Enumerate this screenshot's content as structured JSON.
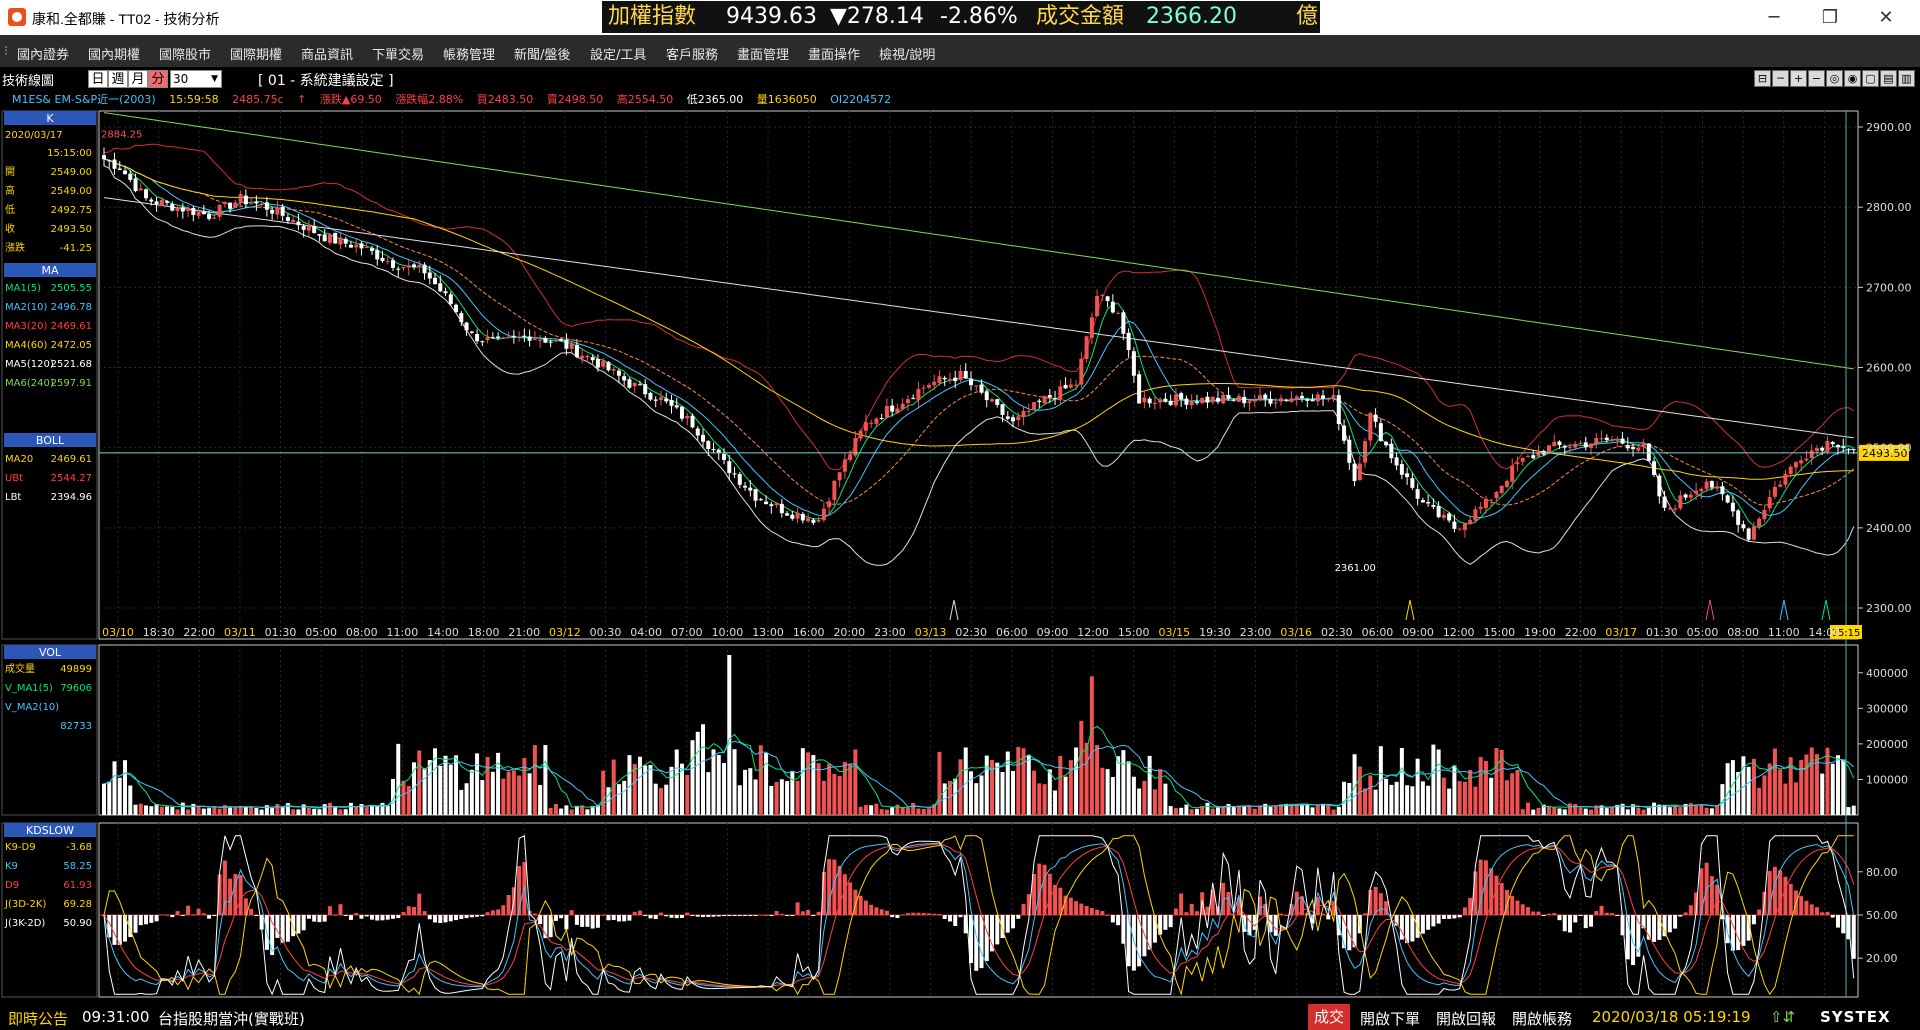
{
  "window": {
    "title": "康和.全都賺 - TT02 - 技術分析",
    "minimize": "─",
    "restore": "❐",
    "close": "✕"
  },
  "ticker": {
    "index_name": "加權指數",
    "index_value": "9439.63",
    "change": "▼278.14",
    "change_pct": "-2.86%",
    "turnover_label": "成交金額",
    "turnover_value": "2366.20",
    "unit": "億"
  },
  "menu": [
    "國內證券",
    "國內期權",
    "國際股市",
    "國際期權",
    "商品資訊",
    "下單交易",
    "帳務管理",
    "新聞/盤後",
    "設定/工具",
    "客戶服務",
    "畫面管理",
    "畫面操作",
    "檢視/說明"
  ],
  "toolbar": {
    "label": "技術線圖",
    "periods": [
      "日",
      "週",
      "月",
      "分"
    ],
    "period_value": "30",
    "setting": "[ 01 - 系統建議設定 ]",
    "buttons": [
      "⊟",
      "─",
      "+",
      "−",
      "◎",
      "◉",
      "▢",
      "▤",
      "▥"
    ]
  },
  "quote": {
    "symbol": "M1ES&  EM-S&P近一(2003)",
    "time": "15:59:58",
    "last": "2485.75c",
    "arrow": "↑",
    "change": "漲跌▲69.50",
    "change_pct": "漲跌幅2.88%",
    "bid": "買2483.50",
    "ask": "賣2498.50",
    "high": "高2554.50",
    "low": "低2365.00",
    "volume": "量1636050",
    "oi": "OI2204572"
  },
  "panels": {
    "k": {
      "header": "K",
      "date": "2020/03/17",
      "time": "15:15:00",
      "rows": [
        {
          "label": "開",
          "value": "2549.00"
        },
        {
          "label": "高",
          "value": "2549.00"
        },
        {
          "label": "低",
          "value": "2492.75"
        },
        {
          "label": "收",
          "value": "2493.50"
        },
        {
          "label": "漲跌",
          "value": "-41.25"
        }
      ]
    },
    "ma": {
      "header": "MA",
      "rows": [
        {
          "label": "MA1(5)",
          "value": "2505.55",
          "color": "#00e676"
        },
        {
          "label": "MA2(10)",
          "value": "2496.78",
          "color": "#40c4ff"
        },
        {
          "label": "MA3(20)",
          "value": "2469.61",
          "color": "#ff4040"
        },
        {
          "label": "MA4(60)",
          "value": "2472.05",
          "color": "#ffd600"
        },
        {
          "label": "MA5(120)",
          "value": "2521.68",
          "color": "#ffffff"
        },
        {
          "label": "MA6(240)",
          "value": "2597.91",
          "color": "#7ed957"
        }
      ]
    },
    "boll": {
      "header": "BOLL",
      "rows": [
        {
          "label": "MA20",
          "value": "2469.61",
          "color": "#ffd600"
        },
        {
          "label": "UBt",
          "value": "2544.27",
          "color": "#ff4040"
        },
        {
          "label": "LBt",
          "value": "2394.96",
          "color": "#ffffff"
        }
      ]
    },
    "vol": {
      "header": "VOL",
      "rows": [
        {
          "label": "成交量",
          "value": "49899",
          "color": "#ffd600"
        },
        {
          "label": "V_MA1(5)",
          "value": "79606",
          "color": "#00e676"
        },
        {
          "label": "V_MA2(10)",
          "value": "",
          "color": "#40c4ff"
        },
        {
          "label": "",
          "value": "82733",
          "color": "#40c4ff"
        }
      ]
    },
    "kd": {
      "header": "KDSLOW",
      "rows": [
        {
          "label": "K9-D9",
          "value": "-3.68",
          "color": "#ffd600"
        },
        {
          "label": "K9",
          "value": "58.25",
          "color": "#40c4ff"
        },
        {
          "label": "D9",
          "value": "61.93",
          "color": "#ff4040"
        },
        {
          "label": "J(3D-2K)",
          "value": "69.28",
          "color": "#ffd600"
        },
        {
          "label": "J(3K-2D)",
          "value": "50.90",
          "color": "#ffffff"
        }
      ]
    }
  },
  "price_axis": [
    "2900.00",
    "2800.00",
    "2700.00",
    "2600.00",
    "2500.00",
    "2400.00",
    "2300.00"
  ],
  "price_labels": {
    "first_high": "2884.25",
    "low_mark": "2361.00",
    "last_price": "2493.50",
    "last_time": "15:15"
  },
  "vol_axis": [
    "400000",
    "300000",
    "200000",
    "100000"
  ],
  "kd_axis": [
    "80.00",
    "50.00",
    "20.00"
  ],
  "time_axis": [
    {
      "label": "03/10",
      "date": true
    },
    {
      "label": "18:30"
    },
    {
      "label": "22:00"
    },
    {
      "label": "03/11",
      "date": true
    },
    {
      "label": "01:30"
    },
    {
      "label": "05:00"
    },
    {
      "label": "08:00"
    },
    {
      "label": "11:00"
    },
    {
      "label": "14:00"
    },
    {
      "label": "18:00"
    },
    {
      "label": "21:00"
    },
    {
      "label": "03/12",
      "date": true
    },
    {
      "label": "00:30"
    },
    {
      "label": "04:00"
    },
    {
      "label": "07:00"
    },
    {
      "label": "10:00"
    },
    {
      "label": "13:00"
    },
    {
      "label": "16:00"
    },
    {
      "label": "20:00"
    },
    {
      "label": "23:00"
    },
    {
      "label": "03/13",
      "date": true
    },
    {
      "label": "02:30"
    },
    {
      "label": "06:00"
    },
    {
      "label": "09:00"
    },
    {
      "label": "12:00"
    },
    {
      "label": "15:00"
    },
    {
      "label": "03/15",
      "date": true
    },
    {
      "label": "19:30"
    },
    {
      "label": "23:00"
    },
    {
      "label": "03/16",
      "date": true
    },
    {
      "label": "02:30"
    },
    {
      "label": "06:00"
    },
    {
      "label": "09:00"
    },
    {
      "label": "12:00"
    },
    {
      "label": "15:00"
    },
    {
      "label": "19:00"
    },
    {
      "label": "22:00"
    },
    {
      "label": "03/17",
      "date": true
    },
    {
      "label": "01:30"
    },
    {
      "label": "05:00"
    },
    {
      "label": "08:00"
    },
    {
      "label": "11:00"
    },
    {
      "label": "14:00"
    }
  ],
  "chart_data": {
    "type": "candlestick",
    "ylim": [
      2300,
      2920
    ],
    "keypoints": [
      [
        0,
        2860
      ],
      [
        3,
        2850
      ],
      [
        8,
        2810
      ],
      [
        14,
        2800
      ],
      [
        20,
        2790
      ],
      [
        26,
        2810
      ],
      [
        31,
        2800
      ],
      [
        37,
        2780
      ],
      [
        43,
        2760
      ],
      [
        49,
        2750
      ],
      [
        55,
        2730
      ],
      [
        61,
        2720
      ],
      [
        66,
        2680
      ],
      [
        70,
        2640
      ],
      [
        75,
        2630
      ],
      [
        81,
        2640
      ],
      [
        87,
        2630
      ],
      [
        93,
        2610
      ],
      [
        100,
        2580
      ],
      [
        106,
        2560
      ],
      [
        112,
        2530
      ],
      [
        118,
        2480
      ],
      [
        124,
        2440
      ],
      [
        130,
        2420
      ],
      [
        136,
        2410
      ],
      [
        140,
        2470
      ],
      [
        145,
        2530
      ],
      [
        151,
        2555
      ],
      [
        157,
        2580
      ],
      [
        163,
        2590
      ],
      [
        168,
        2560
      ],
      [
        173,
        2530
      ],
      [
        179,
        2560
      ],
      [
        185,
        2580
      ],
      [
        189,
        2690
      ],
      [
        193,
        2670
      ],
      [
        197,
        2560
      ],
      [
        205,
        2560
      ],
      [
        213,
        2560
      ],
      [
        221,
        2560
      ],
      [
        229,
        2565
      ],
      [
        234,
        2560
      ],
      [
        238,
        2460
      ],
      [
        241,
        2540
      ],
      [
        245,
        2490
      ],
      [
        251,
        2430
      ],
      [
        257,
        2400
      ],
      [
        263,
        2430
      ],
      [
        269,
        2480
      ],
      [
        275,
        2500
      ],
      [
        281,
        2505
      ],
      [
        287,
        2510
      ],
      [
        293,
        2500
      ],
      [
        297,
        2420
      ],
      [
        301,
        2440
      ],
      [
        305,
        2460
      ],
      [
        309,
        2430
      ],
      [
        313,
        2390
      ],
      [
        318,
        2450
      ],
      [
        323,
        2490
      ],
      [
        329,
        2510
      ],
      [
        333,
        2495
      ]
    ]
  },
  "status": {
    "announce": "即時公告",
    "time": "09:31:00",
    "headline": "台指股期當沖(實戰班)",
    "deal": "成交",
    "open_order": "開啟下單",
    "open_report": "開啟回報",
    "open_account": "開啟帳務",
    "datetime": "2020/03/18 05:19:19",
    "brand": "SYSTEX"
  }
}
